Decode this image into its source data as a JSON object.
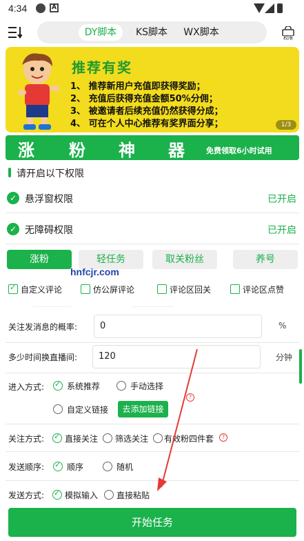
{
  "statusbar": {
    "time": "4:34",
    "icon_a": "A"
  },
  "tabs": [
    {
      "label": "DY脚本",
      "active": true
    },
    {
      "label": "KS脚本",
      "active": false
    },
    {
      "label": "WX脚本",
      "active": false
    }
  ],
  "header": {
    "perm_label": "权限"
  },
  "banner": {
    "title": "推荐有奖",
    "lines": [
      "1、 推荐新用户充值即获得奖励；",
      "2、 充值后获得充值金额50%分佣；",
      "3、 被邀请者后续充值仍然获得分成；",
      "4、 可在个人中心推荐有奖界面分享；"
    ],
    "page": "1/3"
  },
  "titlebar": {
    "chars": [
      "涨",
      "粉",
      "神",
      "器"
    ],
    "subtitle": "免费领取6小时试用"
  },
  "permissions": {
    "title": "请开启以下权限",
    "items": [
      {
        "label": "悬浮窗权限",
        "state": "已开启"
      },
      {
        "label": "无障碍权限",
        "state": "已开启"
      }
    ]
  },
  "modes": [
    {
      "label": "涨粉",
      "active": true
    },
    {
      "label": "轻任务",
      "active": false
    },
    {
      "label": "取关粉丝",
      "active": false
    },
    {
      "label": "养号",
      "active": false
    }
  ],
  "watermark": "hnfcjr.com",
  "comment_options": [
    {
      "label": "自定义评论",
      "checked": true
    },
    {
      "label": "仿公屏评论",
      "checked": false
    },
    {
      "label": "评论区回关",
      "checked": false
    },
    {
      "label": "评论区点赞",
      "checked": false
    }
  ],
  "form": {
    "follow_prob_label": "关注发消息的概率:",
    "follow_prob_value": "0",
    "follow_prob_unit": "%",
    "switch_label": "多少时间换直播间:",
    "switch_value": "120",
    "switch_unit": "分钟",
    "enter_label": "进入方式:",
    "enter_options": [
      "系统推荐",
      "手动选择",
      "自定义链接"
    ],
    "add_link": "去添加链接",
    "follow_label": "关注方式:",
    "follow_options": [
      "直接关注",
      "筛选关注",
      "有效粉四件套"
    ],
    "order_label": "发送顺序:",
    "order_options": [
      "顺序",
      "随机"
    ],
    "send_label": "发送方式:",
    "send_options": [
      "模拟输入",
      "直接粘贴"
    ]
  },
  "start_button": "开始任务",
  "colors": {
    "accent": "#1bb14b",
    "banner": "#f2dc1d"
  }
}
